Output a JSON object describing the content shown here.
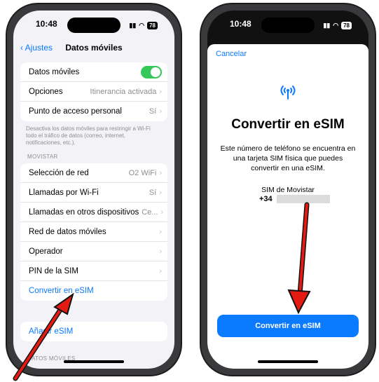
{
  "left_phone": {
    "status": {
      "time": "10:48",
      "battery": "78"
    },
    "nav": {
      "back_label": "Ajustes",
      "title": "Datos móviles"
    },
    "group1": [
      {
        "label": "Datos móviles",
        "value": "",
        "toggle": true
      },
      {
        "label": "Opciones",
        "value": "Itinerancia activada"
      },
      {
        "label": "Punto de acceso personal",
        "value": "Sí"
      }
    ],
    "footnote": "Desactiva los datos móviles para restringir a Wi-Fi todo el tráfico de datos (correo, internet, notificaciones, etc.).",
    "section_header": "MOVISTAR",
    "group2": [
      {
        "label": "Selección de red",
        "value": "O2 WiFi"
      },
      {
        "label": "Llamadas por Wi-Fi",
        "value": "Sí"
      },
      {
        "label": "Llamadas en otros dispositivos",
        "value": "Ce..."
      },
      {
        "label": "Red de datos móviles",
        "value": ""
      },
      {
        "label": "Operador",
        "value": ""
      },
      {
        "label": "PIN de la SIM",
        "value": ""
      },
      {
        "label": "Convertir en eSIM",
        "value": ""
      }
    ],
    "add_esim": "Añadir eSIM",
    "bottom_section": "DATOS MÓVILES"
  },
  "right_phone": {
    "status": {
      "time": "10:48",
      "battery": "78"
    },
    "cancel": "Cancelar",
    "title": "Convertir en eSIM",
    "description": "Este número de teléfono se encuentra en una tarjeta SIM física que puedes convertir en una eSIM.",
    "sim_name": "SIM de Movistar",
    "sim_prefix": "+34",
    "button": "Convertir en eSIM"
  },
  "colors": {
    "accent": "#0a7aff",
    "toggle_on": "#34c759",
    "arrow": "#e41b13"
  }
}
